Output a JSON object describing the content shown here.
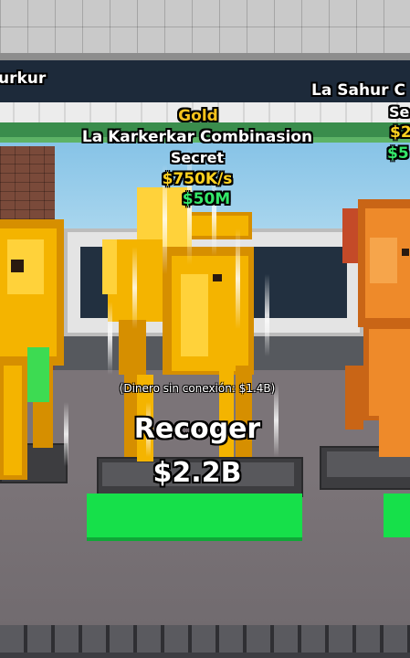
{
  "left_pet": {
    "name_partial": "urkur"
  },
  "center_pet": {
    "rarity_mutation": "Gold",
    "name": "La Karkerkar Combinasion",
    "tier": "Secret",
    "income_rate": "$750K/s",
    "price_partial": "$50M",
    "offline_earnings": "(Dinero sin conexión: $1.4B)",
    "collect_label": "Recoger",
    "collect_amount": "$2.2B"
  },
  "right_pet": {
    "name_partial": "La Sahur C",
    "tier_partial": "Se",
    "income_partial": "$2",
    "price_partial": "$5"
  },
  "colors": {
    "gold_text": "#f6c21c",
    "secret_text": "#ffffff",
    "income_text": "#ffd21f",
    "price_text": "#34e86a",
    "collect_pad": "#16e04a"
  }
}
